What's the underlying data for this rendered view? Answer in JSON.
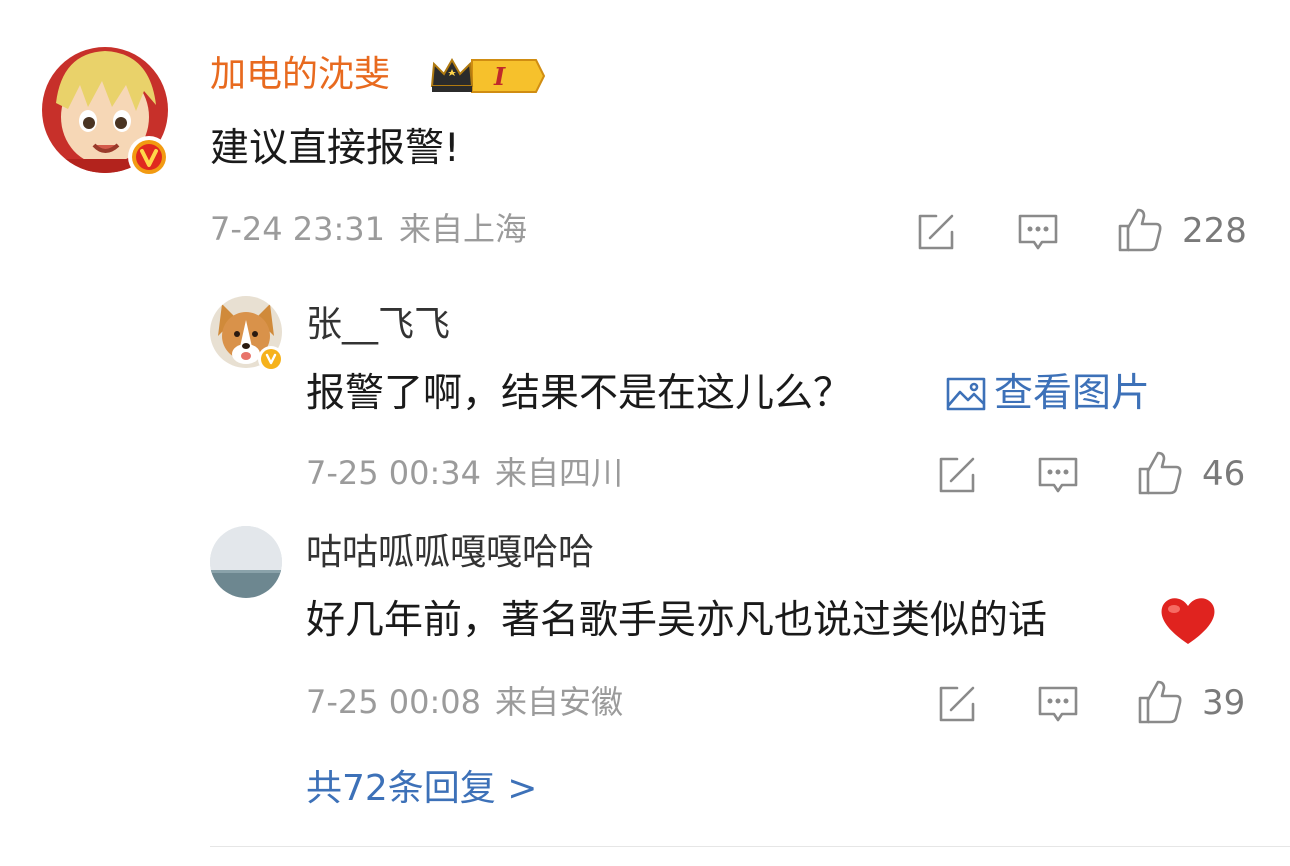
{
  "comment": {
    "username": "加电的沈斐",
    "level_badge": "I",
    "text": "建议直接报警!",
    "date": "7-24 23:31",
    "location": "来自上海",
    "likes": "228"
  },
  "replies": [
    {
      "username": "张__飞飞",
      "text": "报警了啊，结果不是在这儿么？",
      "link": "查看图片",
      "date": "7-25 00:34",
      "location": "来自四川",
      "likes": "46"
    },
    {
      "username": "咕咕呱呱嘎嘎哈哈",
      "text": "好几年前，著名歌手吴亦凡也说过类似的话",
      "date": "7-25 00:08",
      "location": "来自安徽",
      "likes": "39"
    }
  ],
  "more_replies": "共72条回复 >",
  "colors": {
    "username_primary": "#e86a1f",
    "link_blue": "#3d71b8",
    "meta_gray": "#9b9b9b",
    "verified_orange": "#f29b12"
  },
  "icons": [
    "share-icon",
    "comment-icon",
    "like-icon",
    "image-icon",
    "crown-icon",
    "verified-icon",
    "heart-icon"
  ]
}
